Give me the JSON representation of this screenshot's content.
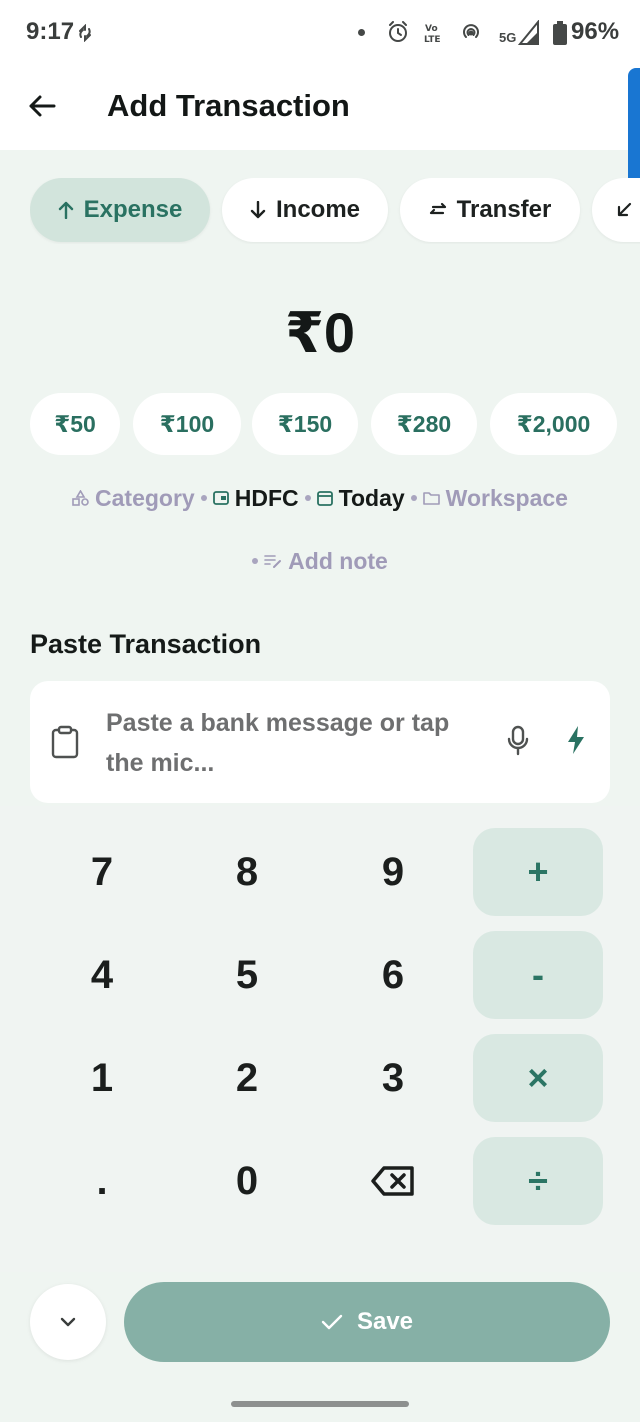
{
  "status_bar": {
    "time": "9:17",
    "network": "5G",
    "battery": "96%",
    "icons": [
      "sync-icon",
      "alarm-icon",
      "volte-icon",
      "hotspot-icon",
      "signal-icon",
      "battery-icon"
    ]
  },
  "header": {
    "title": "Add Transaction",
    "back_icon": "arrow-left-icon"
  },
  "type_tabs": [
    {
      "label": "Expense",
      "icon": "arrow-up-icon",
      "active": true
    },
    {
      "label": "Income",
      "icon": "arrow-down-icon",
      "active": false
    },
    {
      "label": "Transfer",
      "icon": "swap-icon",
      "active": false
    }
  ],
  "amount": "₹0",
  "quick_amounts": [
    "₹50",
    "₹100",
    "₹150",
    "₹280",
    "₹2,000"
  ],
  "meta": {
    "category": "Category",
    "account": "HDFC",
    "date": "Today",
    "workspace": "Workspace",
    "note": "Add note"
  },
  "paste": {
    "title": "Paste Transaction",
    "placeholder": "Paste a bank message or tap the mic..."
  },
  "keypad": {
    "keys": [
      "7",
      "8",
      "9",
      "4",
      "5",
      "6",
      "1",
      "2",
      "3",
      ".",
      "0"
    ],
    "operators": [
      "+",
      "-",
      "×",
      "÷"
    ]
  },
  "save_label": "Save",
  "colors": {
    "accent": "#2a7262",
    "active_chip": "#d2e4dc",
    "operator_key": "#d9e8e2",
    "save_button": "#86b0a6",
    "muted_text": "#a09bb8",
    "background": "#eff5f1"
  }
}
